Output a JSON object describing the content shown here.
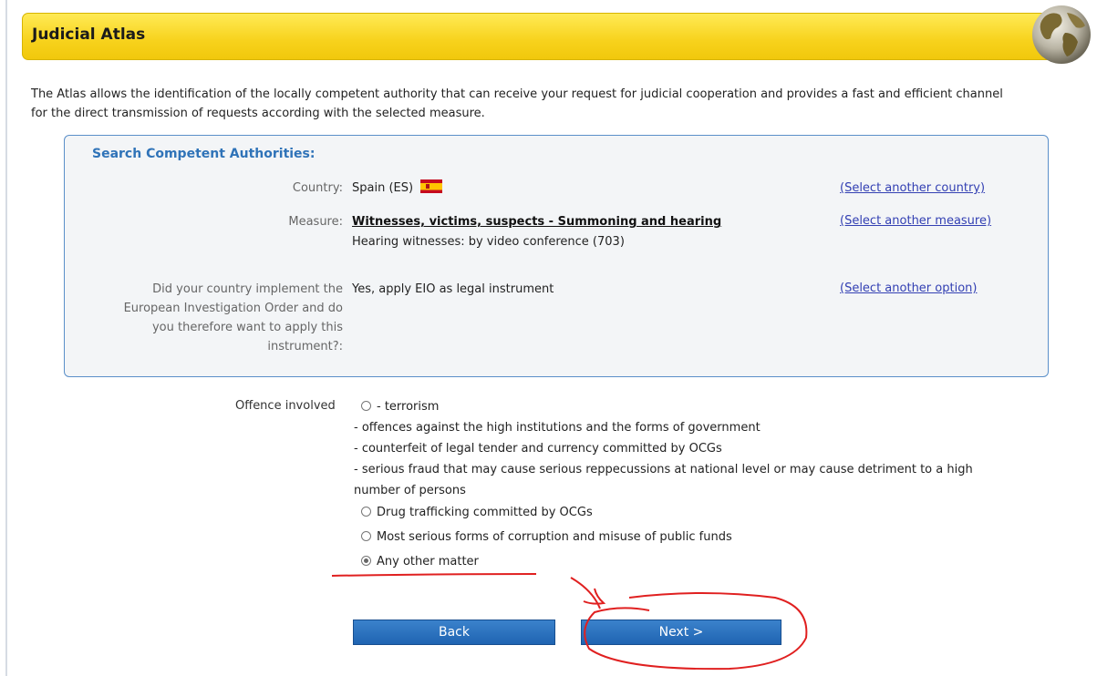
{
  "header": {
    "title": "Judicial Atlas",
    "logo_icon": "globe-icon"
  },
  "intro": {
    "line1": "The Atlas allows the identification of the locally competent authority that can receive your request for judicial cooperation and provides a fast and efficient channel",
    "line2": "for the direct transmission of requests according with the selected measure."
  },
  "search_panel": {
    "title": "Search Competent Authorities:",
    "country": {
      "label": "Country:",
      "value": "Spain (ES)",
      "flag_icon": "spain-flag-icon",
      "link": "(Select another country)"
    },
    "measure": {
      "label": "Measure:",
      "value": "Witnesses, victims, suspects - Summoning and hearing",
      "sub": "Hearing witnesses: by video conference (703)",
      "link": "(Select another measure)"
    },
    "eio": {
      "label_lines": [
        "Did your country implement the",
        "European Investigation Order and do",
        "you therefore want to apply this",
        "instrument?:"
      ],
      "value": "Yes, apply EIO as legal instrument",
      "link": "(Select another option)"
    }
  },
  "offence": {
    "label": "Offence involved",
    "option1_lines": [
      "- terrorism",
      "- offences against the high institutions and the forms of government",
      "- counterfeit of legal tender and currency committed by OCGs",
      "- serious fraud that may cause serious reppecussions at national level or may cause detriment to a high",
      "number of persons"
    ],
    "option2": "Drug trafficking committed by OCGs",
    "option3": "Most serious forms of corruption and misuse of public funds",
    "option4": "Any other matter",
    "selected": "Any other matter"
  },
  "buttons": {
    "back": "Back",
    "next": "Next >"
  },
  "colors": {
    "title_bar": "#f7d21c",
    "accent_blue": "#2f73b8",
    "button_blue": "#2a6fbe",
    "annotation_red": "#e02020"
  }
}
